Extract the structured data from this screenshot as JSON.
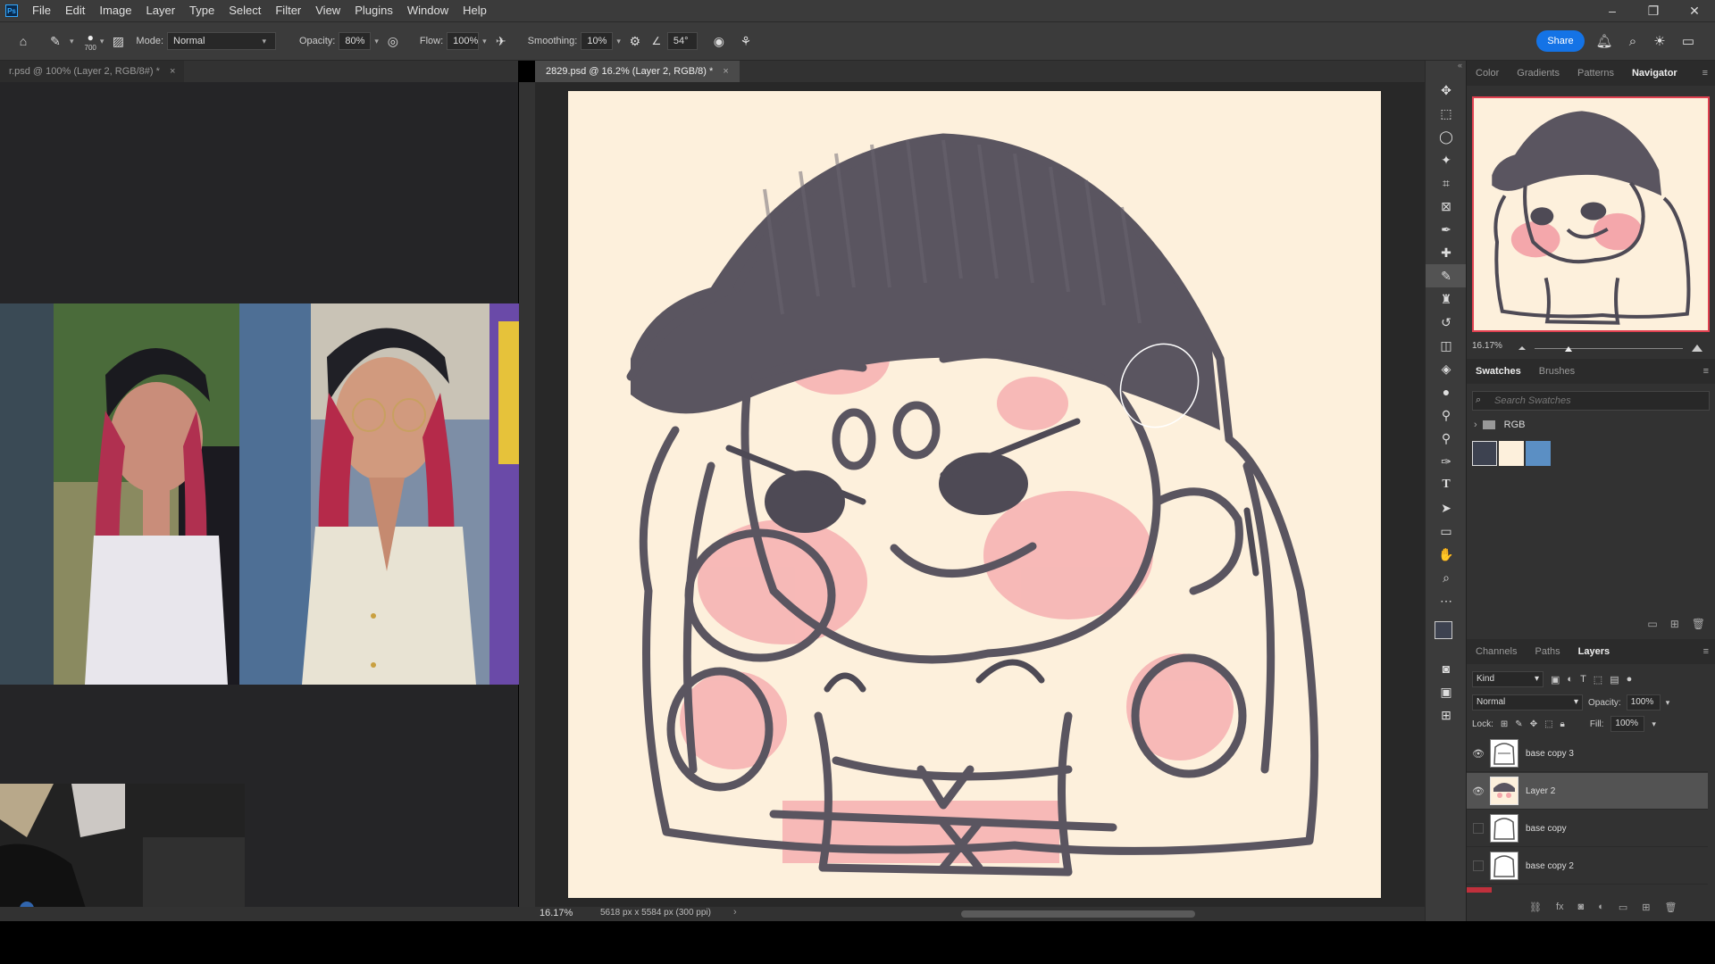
{
  "menu": {
    "logo": "Ps",
    "items": [
      "File",
      "Edit",
      "Image",
      "Layer",
      "Type",
      "Select",
      "Filter",
      "View",
      "Plugins",
      "Window",
      "Help"
    ]
  },
  "window_controls": {
    "minimize": "–",
    "restore": "❐",
    "close": "✕"
  },
  "options": {
    "brush_size": "700",
    "mode_label": "Mode:",
    "mode_value": "Normal",
    "opacity_label": "Opacity:",
    "opacity_value": "80%",
    "flow_label": "Flow:",
    "flow_value": "100%",
    "smoothing_label": "Smoothing:",
    "smoothing_value": "10%",
    "angle_value": "54°",
    "share_label": "Share"
  },
  "tabs": {
    "left_doc": "r.psd @ 100% (Layer 2, RGB/8#) *",
    "main_doc": "2829.psd @ 16.2% (Layer 2, RGB/8) *",
    "close": "×"
  },
  "status": {
    "zoom": "16.17%",
    "doc_info": "5618 px x 5584 px (300 ppi)",
    "arrow": "›"
  },
  "top_panel": {
    "tabs": [
      "Color",
      "Gradients",
      "Patterns",
      "Navigator"
    ],
    "active": "Navigator",
    "zoom": "16.17%"
  },
  "swatches_panel": {
    "tabs": [
      "Swatches",
      "Brushes"
    ],
    "active": "Swatches",
    "search_placeholder": "Search Swatches",
    "group_name": "RGB",
    "colors": [
      "#3d4250",
      "#fdf0dc",
      "#5b8fc4"
    ]
  },
  "layers_panel": {
    "tabs": [
      "Channels",
      "Paths",
      "Layers"
    ],
    "active": "Layers",
    "kind_label": "Kind",
    "blend_mode": "Normal",
    "opacity_label": "Opacity:",
    "opacity_value": "100%",
    "lock_label": "Lock:",
    "fill_label": "Fill:",
    "fill_value": "100%",
    "layers": [
      {
        "name": "base copy 3",
        "visible": true,
        "selected": false
      },
      {
        "name": "Layer 2",
        "visible": true,
        "selected": true
      },
      {
        "name": "base copy",
        "visible": false,
        "selected": false
      },
      {
        "name": "base copy 2",
        "visible": false,
        "selected": false
      }
    ]
  }
}
